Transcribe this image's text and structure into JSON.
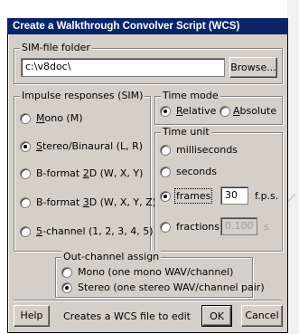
{
  "dialog": {
    "title": "Create a Walkthrough Convolver Script (WCS)"
  },
  "sim_folder": {
    "legend": "SIM-file folder",
    "value": "c:\\v8doc\\",
    "browse_label": "Browse..."
  },
  "impulse": {
    "legend": "Impulse responses (SIM)",
    "options": [
      {
        "pre": "",
        "u": "M",
        "post": "ono (M)",
        "checked": false
      },
      {
        "pre": "",
        "u": "S",
        "post": "tereo/Binaural (L, R)",
        "checked": true
      },
      {
        "pre": "B-format ",
        "u": "2",
        "post": "D (W, X, Y)",
        "checked": false
      },
      {
        "pre": "B-format ",
        "u": "3",
        "post": "D (W, X, Y, Z)",
        "checked": false
      },
      {
        "pre": "",
        "u": "5",
        "post": "-channel (1, 2, 3, 4, 5)",
        "checked": false
      }
    ]
  },
  "time_mode": {
    "legend": "Time mode",
    "relative_u": "R",
    "relative_rest": "elative",
    "absolute_u": "A",
    "absolute_rest": "bsolute"
  },
  "time_unit": {
    "legend": "Time unit",
    "milliseconds": "milliseconds",
    "seconds": "seconds",
    "frames": "frames",
    "fps_value": "30",
    "fps_label": "f.p.s.",
    "fractions": "fractions",
    "fractions_value": "0.100",
    "fractions_unit": "s"
  },
  "out_channel": {
    "legend": "Out-channel assign",
    "mono": "Mono (one mono WAV/channel)",
    "stereo": "Stereo (one stereo WAV/channel pair)"
  },
  "footer": {
    "help_label": "Help",
    "hint": "Creates a WCS file to edit",
    "ok_label": "OK",
    "cancel_label": "Cancel"
  }
}
